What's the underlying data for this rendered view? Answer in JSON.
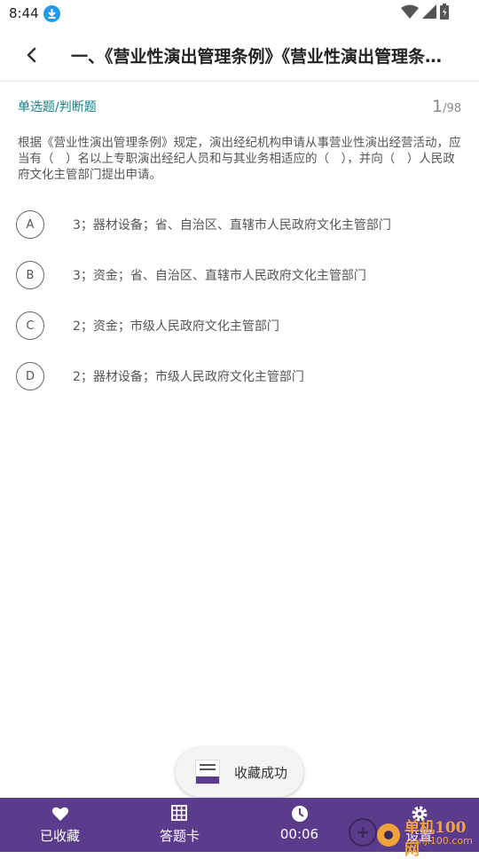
{
  "status_bar": {
    "time": "8:44"
  },
  "header": {
    "title": "一、《营业性演出管理条例》《营业性演出管理条例》"
  },
  "question": {
    "type": "单选题/判断题",
    "current": "1",
    "total": "/98",
    "text": "根据《营业性演出管理条例》规定，演出经纪机构申请从事营业性演出经营活动，应当有（　）名以上专职演出经纪人员和与其业务相适应的（　），并向（　）人民政府文化主管部门提出申请。",
    "options": [
      {
        "letter": "A",
        "text": "3；器材设备；省、自治区、直辖市人民政府文化主管部门"
      },
      {
        "letter": "B",
        "text": "3；资金；省、自治区、直辖市人民政府文化主管部门"
      },
      {
        "letter": "C",
        "text": "2；资金；市级人民政府文化主管部门"
      },
      {
        "letter": "D",
        "text": "2；器材设备；市级人民政府文化主管部门"
      }
    ]
  },
  "toast": {
    "text": "收藏成功"
  },
  "bottom_bar": {
    "favorite_label": "已收藏",
    "answer_card_label": "答题卡",
    "timer": "00:06",
    "settings_label": "设置"
  },
  "watermark": {
    "line1": "单机100网",
    "line2": "danji100.com"
  },
  "colors": {
    "accent": "#5a3b8c",
    "type_label": "#17808a",
    "watermark": "#f0a33a"
  }
}
